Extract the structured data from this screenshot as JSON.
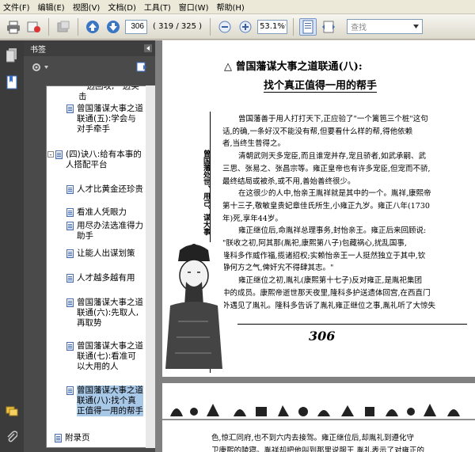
{
  "menu": [
    "文件(F)",
    "编辑(E)",
    "视图(V)",
    "文档(D)",
    "工具(T)",
    "窗口(W)",
    "帮助(H)"
  ],
  "toolbar": {
    "page_value": "306",
    "page_count": "( 319 / 325 )",
    "zoom_value": "53.1%",
    "search_placeholder": "查找"
  },
  "panel": {
    "title": "书签"
  },
  "bookmarks": [
    {
      "text": "一边回攻,一边突击"
    },
    {
      "text": "曾国藩谋大事之道联通(五):学会与对手牵手"
    },
    {
      "text": "(四)诀八:给有本事的人搭配平台"
    },
    {
      "text": "人才比黄金还珍贵"
    },
    {
      "text": "看准人凭眼力"
    },
    {
      "text": "用尽办法选准得力助手"
    },
    {
      "text": "让能人出谋划策"
    },
    {
      "text": "人才越多越有用"
    },
    {
      "text": "曾国藩谋大事之道联通(六):先取人,再取势"
    },
    {
      "text": "曾国藩谋大事之道联通(七):看准可以大用的人"
    },
    {
      "text": "曾国藩谋大事之道联通(八):找个真正值得一用的帮手"
    },
    {
      "text": "附录页"
    }
  ],
  "document": {
    "heading1": "△ 曾国藩谋大事之道联通(八):",
    "heading2": "找个真正值得一用的帮手",
    "side_title": "曾国藩处世、用己、谋大事",
    "paragraphs": [
      "曾国藩善于用人打打天下,正应验了\"一个篱笆三个桩\"这句",
      "话,的确,一条好汉不能没有帮,但要看什么样的帮,得他依赖",
      "者,当终生普得之。",
      "清朝武则天多宠臣,而且谁宠并存,宠且骄者,如武承嗣、武",
      "三思、张易之、张昌宗等。雍正皇帝也有许多宠臣,但宠而不骄,",
      "最终结局或被杀,或不用,善始善终很少。",
      "在这很少的人中,怡亲王胤祥就是其中的一个。胤祥,康熙帝",
      "第十三子,敬敏皇贵妃章佳氏所生,小雍正九岁。雍正八年(1730",
      "年)死,享年44岁。",
      "雍正继位后,命胤祥总理事务,封怡亲王。雍正后来回顾说:",
      "\"朕收之初,阿其那(胤祀,康熙第八子)包藏祸心,扰乱国事,",
      "隆科多作威作福,揽诸招权;实赖怡亲王一人挺然独立于其中,钦",
      "静何方之气,俾奸宄不得肆其志。\"",
      "雍正继位之初,胤礼(康熙第十七子)反对雍正,是胤祀集团",
      "中的成员。康熙帝逝世那天夜里,隆科多护送遗体回宫,在西直门",
      "外遇见了胤礼。隆科多告诉了胤礼雍正继位之事,胤礼听了大惊失"
    ],
    "page_number": "306",
    "next_page_line1": "色,惊汇同府,也不到六内去接驾。雍正继位后,却胤礼到遵化守",
    "next_page_line2": "卫康熙的陵寝。胤祥却把他叫到那里说服王,胤礼表示了对雍正的"
  }
}
